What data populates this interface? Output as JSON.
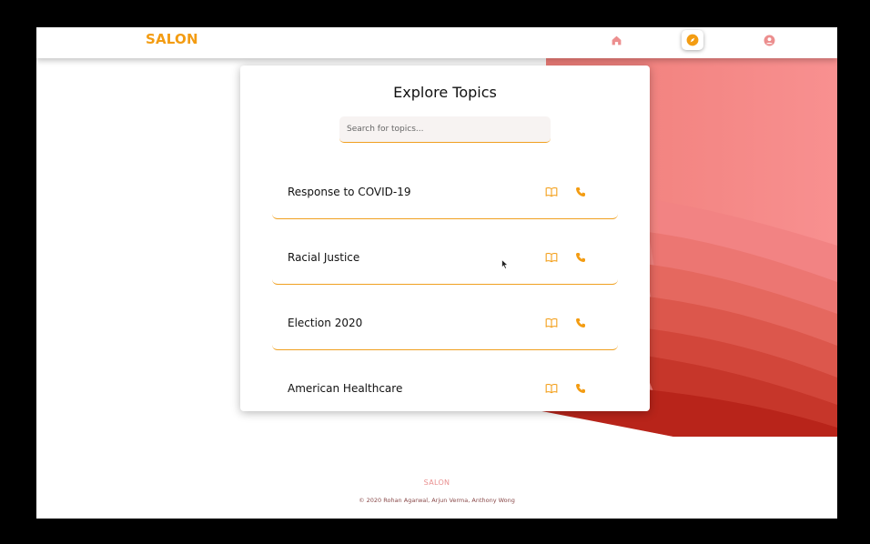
{
  "brand": "SALON",
  "nav": {
    "home_icon": "home-icon",
    "explore_icon": "compass-icon",
    "profile_icon": "user-circle-icon",
    "active": "explore"
  },
  "page": {
    "title": "Explore Topics",
    "search_placeholder": "Search for topics..."
  },
  "topics": [
    {
      "name": "Response to COVID-19",
      "icons": [
        "book-open-icon",
        "phone-icon"
      ]
    },
    {
      "name": "Racial Justice",
      "icons": [
        "book-open-icon",
        "phone-icon"
      ]
    },
    {
      "name": "Election 2020",
      "icons": [
        "book-open-icon",
        "phone-icon"
      ]
    },
    {
      "name": "American Healthcare",
      "icons": [
        "book-open-icon",
        "phone-icon"
      ]
    }
  ],
  "footer": {
    "brand": "SALON",
    "copyright": "© 2020 Rohan Agarwal, Arjun Verma, Anthony Wong"
  },
  "colors": {
    "accent": "#f39c12",
    "nav_inactive": "#ec8e8e",
    "wave_light": "#f58f8f",
    "wave_dark": "#b81f12"
  }
}
